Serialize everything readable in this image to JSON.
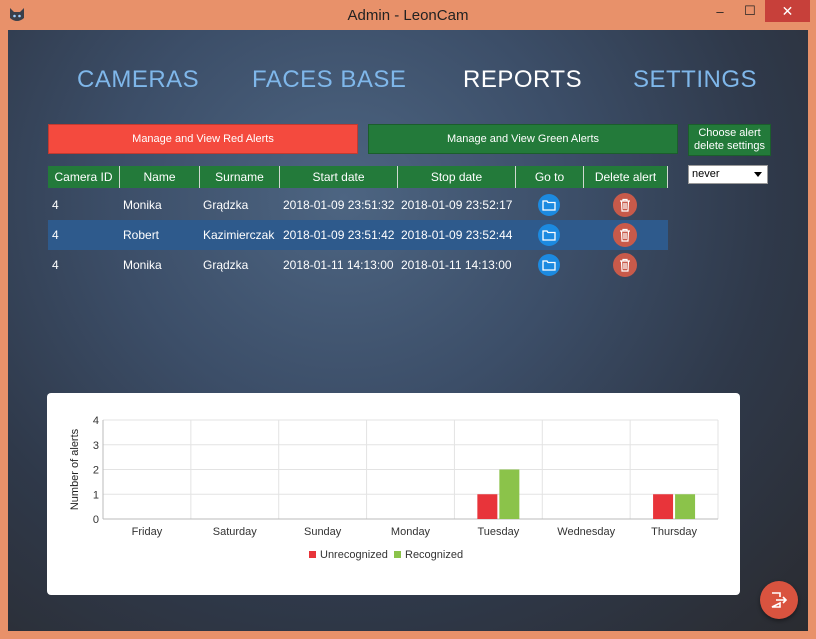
{
  "window": {
    "title": "Admin - LeonCam",
    "min_glyph": "–",
    "max_glyph": "☐",
    "close_glyph": "✕"
  },
  "nav": {
    "cameras": "CAMERAS",
    "faces": "FACES BASE",
    "reports": "REPORTS",
    "settings": "SETTINGS",
    "active": "REPORTS"
  },
  "actions": {
    "red_alerts": "Manage and View Red Alerts",
    "green_alerts": "Manage and View Green Alerts",
    "choose_delete_line1": "Choose alert",
    "choose_delete_line2": "delete settings",
    "delete_setting": "never"
  },
  "table": {
    "headers": [
      "Camera ID",
      "Name",
      "Surname",
      "Start date",
      "Stop date",
      "Go to",
      "Delete alert"
    ],
    "rows": [
      {
        "camera_id": "4",
        "name": "Monika",
        "surname": "Grądzka",
        "start": "2018-01-09 23:51:32",
        "stop": "2018-01-09 23:52:17"
      },
      {
        "camera_id": "4",
        "name": "Robert",
        "surname": "Kazimierczak",
        "start": "2018-01-09 23:51:42",
        "stop": "2018-01-09 23:52:44"
      },
      {
        "camera_id": "4",
        "name": "Monika",
        "surname": "Grądzka",
        "start": "2018-01-11 14:13:00",
        "stop": "2018-01-11 14:13:00"
      }
    ],
    "selected_row": 1
  },
  "colors": {
    "red_alert": "#f44a3e",
    "green_alert": "#237a3a",
    "selected_row": "#2e5a8c",
    "unrecognized": "#e8343a",
    "recognized": "#8bc34a"
  },
  "chart_data": {
    "type": "bar",
    "categories": [
      "Friday",
      "Saturday",
      "Sunday",
      "Monday",
      "Tuesday",
      "Wednesday",
      "Thursday"
    ],
    "series": [
      {
        "name": "Unrecognized",
        "values": [
          0,
          0,
          0,
          0,
          1,
          0,
          1
        ]
      },
      {
        "name": "Recognized",
        "values": [
          0,
          0,
          0,
          0,
          2,
          0,
          1
        ]
      }
    ],
    "ylabel": "Number of alerts",
    "ylim": [
      0,
      4
    ],
    "yticks": [
      "0",
      "1",
      "2",
      "3",
      "4"
    ],
    "grid": true,
    "legend_position": "bottom"
  }
}
